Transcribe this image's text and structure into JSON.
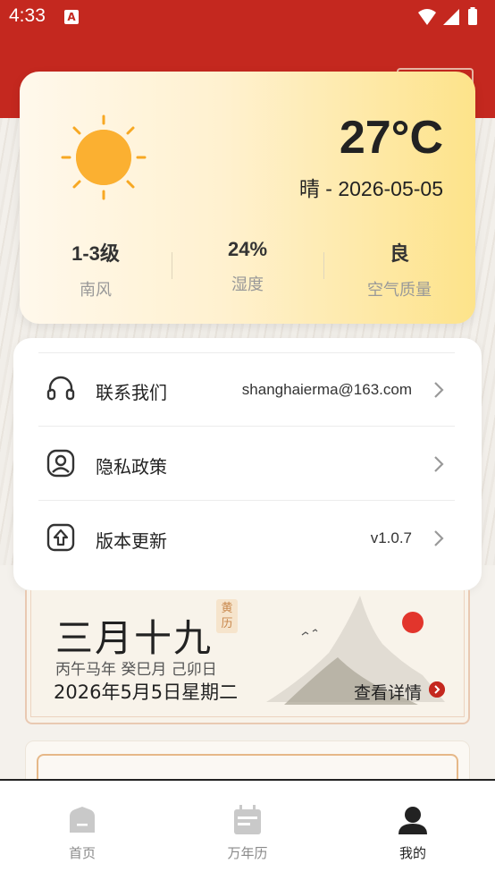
{
  "status_bar": {
    "time": "4:33",
    "notification_glyph": "A"
  },
  "weather": {
    "temperature": "27°C",
    "description": "晴 - 2026-05-05",
    "icon": "sun-icon",
    "stats": [
      {
        "value": "1-3级",
        "label": "南风"
      },
      {
        "value": "24%",
        "label": "湿度"
      },
      {
        "value": "良",
        "label": "空气质量"
      }
    ]
  },
  "menu": {
    "items": [
      {
        "label": "联系我们",
        "value": "shanghaierma@163.com",
        "icon": "headset-icon"
      },
      {
        "label": "隐私政策",
        "value": "",
        "icon": "shield-user-icon"
      },
      {
        "label": "版本更新",
        "value": "v1.0.7",
        "icon": "upload-icon"
      }
    ]
  },
  "almanac": {
    "lunar_date": "三月十九",
    "badge": "黄历",
    "ganzhi": "丙午马年 癸巳月 己卯日",
    "gregorian": "2026年5月5日星期二",
    "detail_label": "查看详情"
  },
  "bottom_nav": {
    "items": [
      {
        "label": "首页",
        "icon": "home-icon",
        "active": false
      },
      {
        "label": "万年历",
        "icon": "calendar-icon",
        "active": false
      },
      {
        "label": "我的",
        "icon": "profile-icon",
        "active": true
      }
    ]
  },
  "colors": {
    "brand_red": "#c4281f",
    "sun": "#f7a823",
    "accent_gold": "#fde38a"
  }
}
